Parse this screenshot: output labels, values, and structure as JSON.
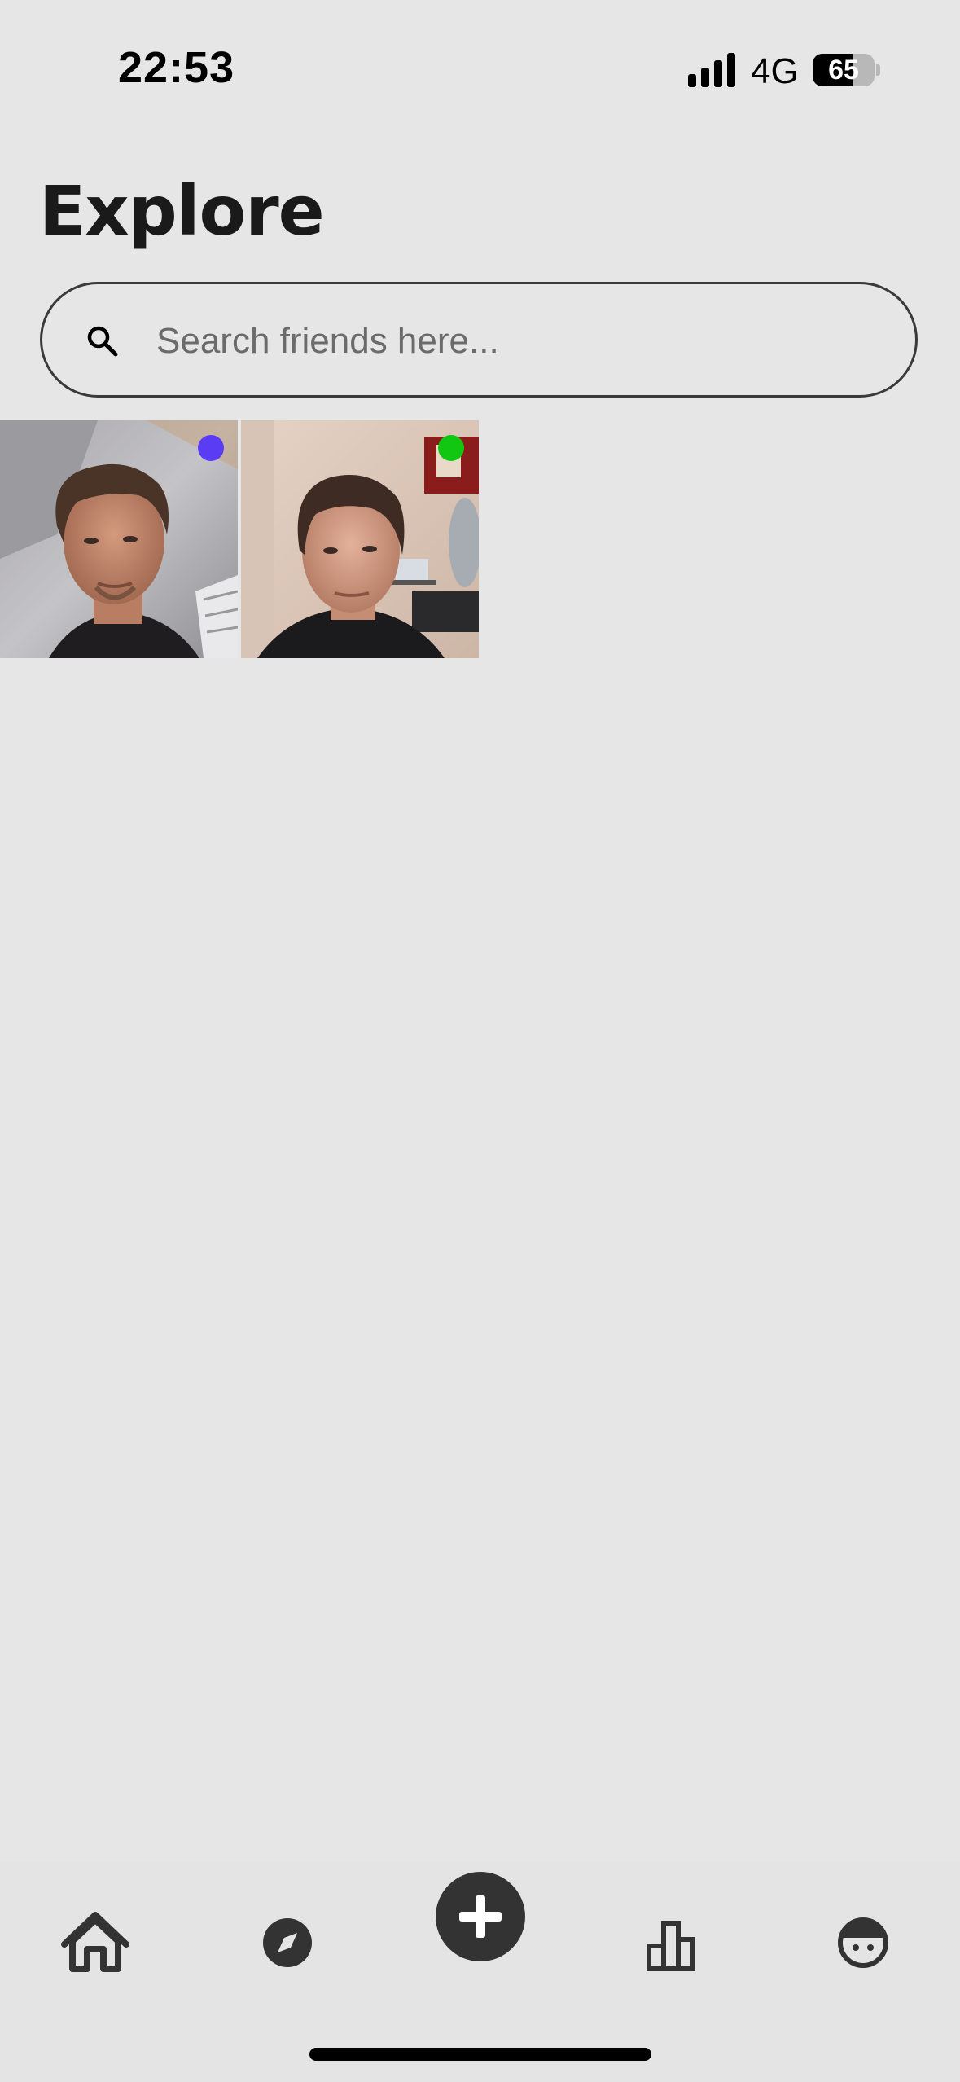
{
  "status_bar": {
    "time": "22:53",
    "network": "4G",
    "battery_level": "65",
    "battery_fraction": 0.65,
    "signal_icon": "signal-bars-icon"
  },
  "header": {
    "title": "Explore"
  },
  "search": {
    "placeholder": "Search friends here...",
    "value": "",
    "icon": "search-icon"
  },
  "friends": [
    {
      "status_color": "#5b3cf5",
      "photo": "friend-photo-1"
    },
    {
      "status_color": "#11c712",
      "photo": "friend-photo-2"
    }
  ],
  "nav": {
    "items": [
      {
        "name": "home",
        "icon": "home-icon"
      },
      {
        "name": "explore",
        "icon": "compass-icon"
      },
      {
        "name": "add",
        "icon": "plus-icon"
      },
      {
        "name": "stats",
        "icon": "bar-chart-icon"
      },
      {
        "name": "profile",
        "icon": "avatar-face-icon"
      }
    ]
  },
  "colors": {
    "background": "#e7e6e7",
    "text": "#1a1a1a",
    "icon": "#333333"
  }
}
